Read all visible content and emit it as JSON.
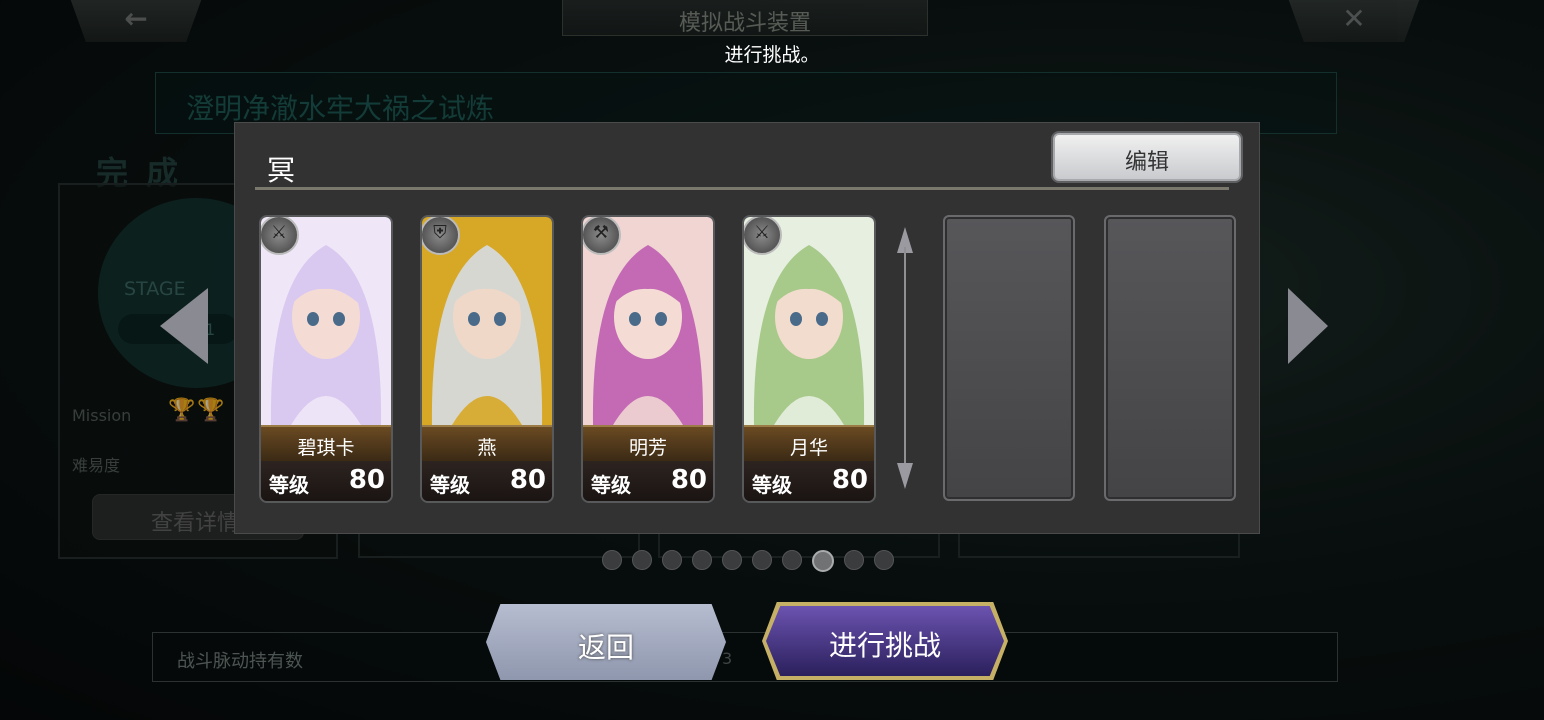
{
  "header": {
    "back_icon": "←",
    "close_icon": "✕",
    "title": "模拟战斗装置",
    "hint": "进行挑战。"
  },
  "background": {
    "trial_name": "澄明净澈水牢大祸之试炼",
    "complete_label": "完成",
    "stage_label": "STAGE",
    "stage_number": "1",
    "mission_label": "Mission",
    "trophies": "🏆🏆",
    "difficulty_label": "难易度",
    "detail_button": "查看详情",
    "pulse_label": "战斗脉动持有数",
    "pulse_value": "3"
  },
  "modal": {
    "team_name": "冥",
    "edit_label": "编辑",
    "characters": [
      {
        "name": "碧琪卡",
        "level_label": "等级",
        "level": "80",
        "class_icon": "⚔",
        "hair": "#d9c9f0",
        "accent": "#efe7f7",
        "skin": "#f4dcd4"
      },
      {
        "name": "燕",
        "level_label": "等级",
        "level": "80",
        "class_icon": "⛨",
        "hair": "#d7d7d2",
        "accent": "#d7a826",
        "skin": "#efd8c8"
      },
      {
        "name": "明芳",
        "level_label": "等级",
        "level": "80",
        "class_icon": "⚒",
        "hair": "#c46ab5",
        "accent": "#f0d5d3",
        "skin": "#f4dcd4"
      },
      {
        "name": "月华",
        "level_label": "等级",
        "level": "80",
        "class_icon": "⚔",
        "hair": "#a7c98a",
        "accent": "#e7efe0",
        "skin": "#f2dcce"
      }
    ]
  },
  "pagination": {
    "total": 10,
    "active": 7
  },
  "buttons": {
    "back_label": "返回",
    "challenge_label": "进行挑战"
  },
  "colors": {
    "modal_bg": "#323233",
    "challenge_btn": "#4b3a8a",
    "back_btn": "#a3abc1",
    "gold_border": "#c6b066"
  }
}
